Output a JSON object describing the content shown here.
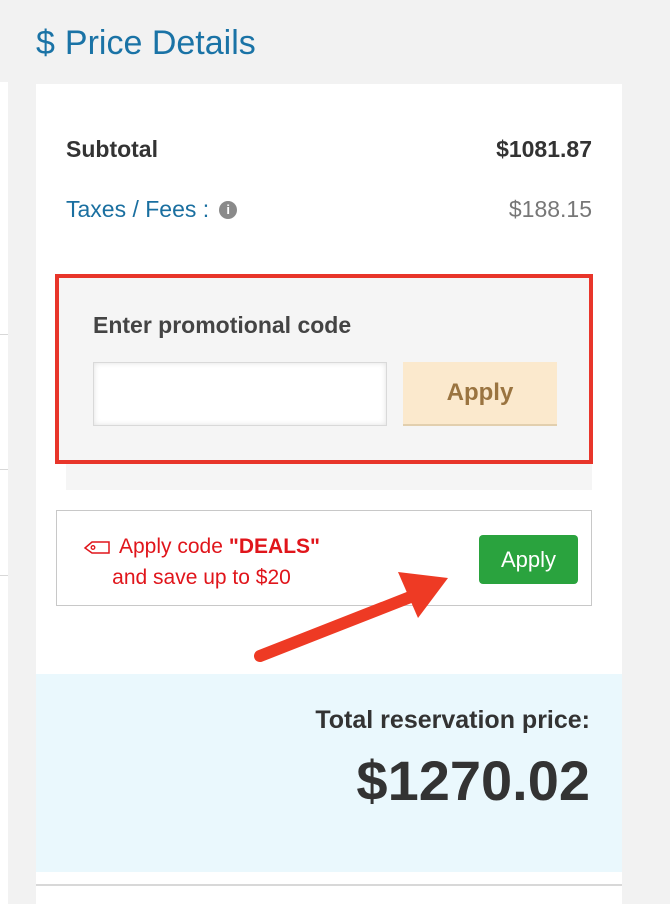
{
  "header": {
    "icon": "dollar-icon",
    "dollar": "$",
    "title": "Price Details"
  },
  "summary": {
    "subtotal_label": "Subtotal",
    "subtotal_value": "$1081.87",
    "taxes_label": "Taxes / Fees :",
    "taxes_value": "$188.15",
    "info_icon": "info-icon"
  },
  "promo": {
    "title": "Enter promotional code",
    "input_value": "",
    "input_placeholder": "",
    "apply_label": "Apply"
  },
  "deal": {
    "icon": "tag-icon",
    "text_prefix": "Apply code",
    "code": "\"DEALS\"",
    "text_line2": "and save up to $20",
    "apply_label": "Apply"
  },
  "total": {
    "label": "Total reservation price:",
    "value": "$1270.02"
  },
  "colors": {
    "accent_blue": "#1a73a6",
    "highlight_red": "#e8352a",
    "deal_red": "#e0151b",
    "apply_green": "#2aa33e",
    "promo_button_bg": "#fbe9cd",
    "total_bg": "#eaf8fd"
  }
}
